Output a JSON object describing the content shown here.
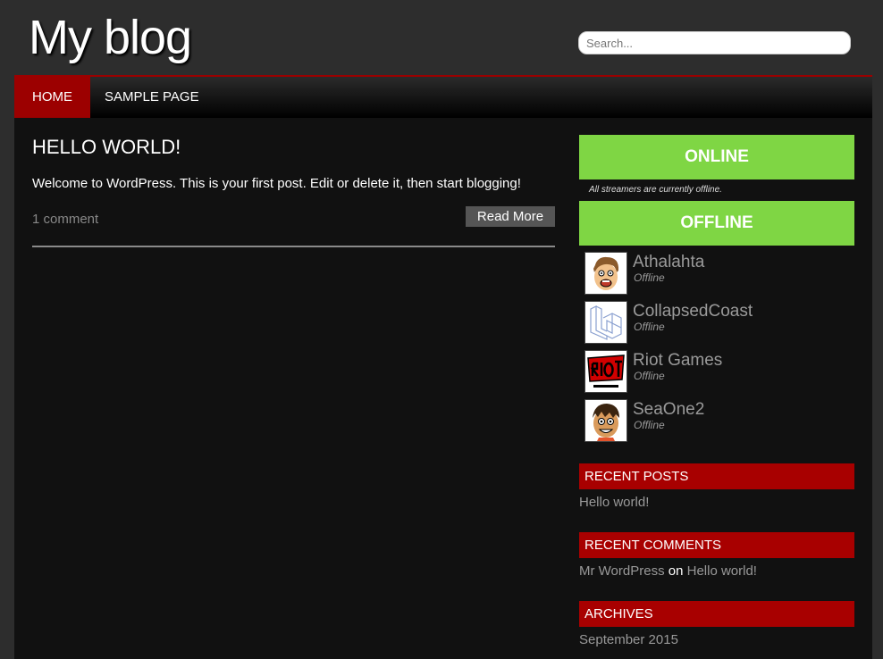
{
  "header": {
    "site_title": "My blog",
    "search_placeholder": "Search..."
  },
  "nav": {
    "items": [
      {
        "label": "HOME",
        "active": true
      },
      {
        "label": "SAMPLE PAGE",
        "active": false
      }
    ]
  },
  "post": {
    "title": "HELLO WORLD!",
    "body": "Welcome to WordPress. This is your first post. Edit or delete it, then start blogging!",
    "comments": "1 comment",
    "read_more": "Read More"
  },
  "sidebar": {
    "online_label": "ONLINE",
    "online_note": "All streamers are currently offline.",
    "offline_label": "OFFLINE",
    "streamers": [
      {
        "name": "Athalahta",
        "status": "Offline",
        "icon": "cartoon-face-icon"
      },
      {
        "name": "CollapsedCoast",
        "status": "Offline",
        "icon": "laravel-logo-icon"
      },
      {
        "name": "Riot Games",
        "status": "Offline",
        "icon": "riot-games-logo-icon"
      },
      {
        "name": "SeaOne2",
        "status": "Offline",
        "icon": "cartoon-boy-icon"
      }
    ],
    "recent_posts": {
      "title": "RECENT POSTS",
      "items": [
        "Hello world!"
      ]
    },
    "recent_comments": {
      "title": "RECENT COMMENTS",
      "author": "Mr WordPress",
      "connector": "on",
      "post": "Hello world!"
    },
    "archives": {
      "title": "ARCHIVES",
      "items": [
        "September 2015"
      ]
    }
  },
  "colors": {
    "accent_red": "#9c0000",
    "online_green": "#7fd644",
    "widget_red": "#a80000",
    "background": "#111111"
  }
}
